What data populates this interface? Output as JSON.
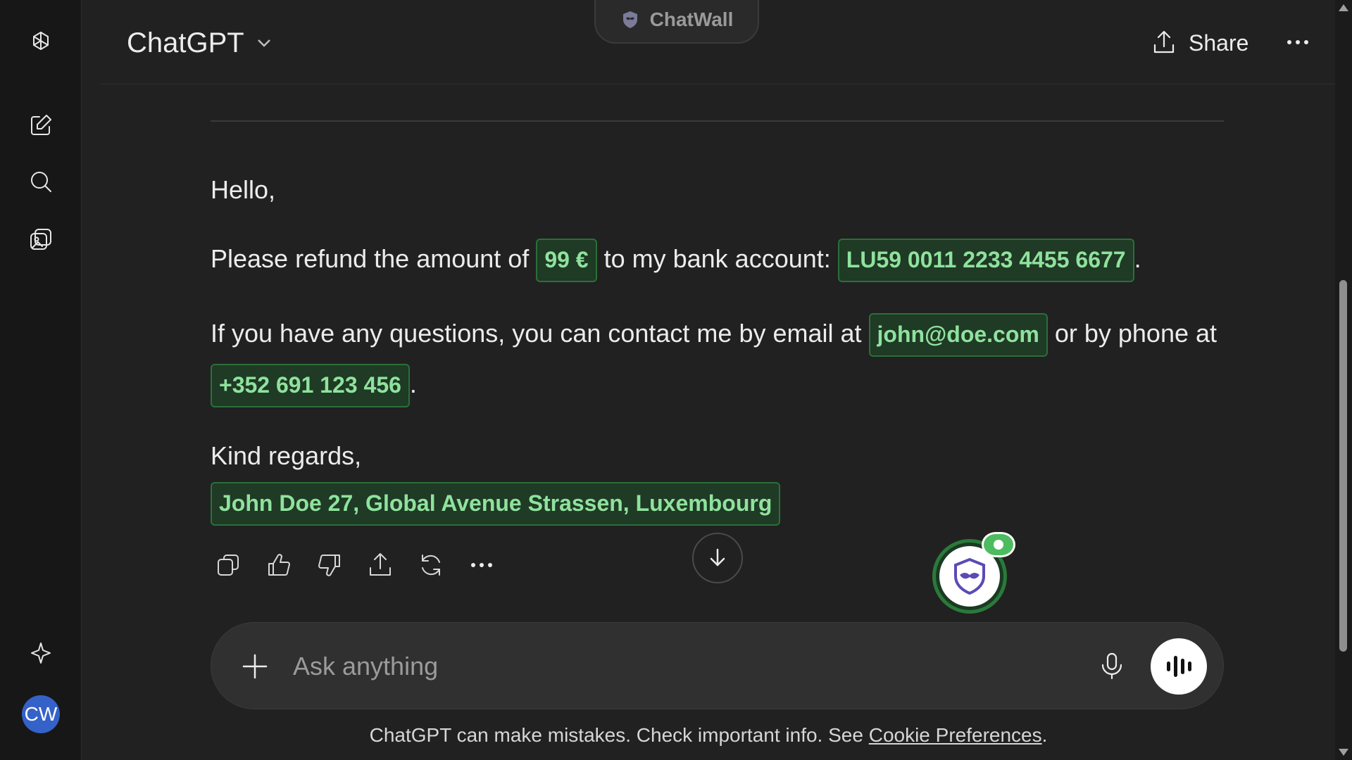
{
  "header": {
    "model_name": "ChatGPT",
    "extension_tab": "ChatWall",
    "share_label": "Share"
  },
  "sidebar": {
    "icons": [
      "openai-logo-icon",
      "new-chat-icon",
      "search-icon",
      "library-icon",
      "sparkle-icon"
    ],
    "avatar_initials": "CW",
    "avatar_color": "#3562c8"
  },
  "message": {
    "greeting": "Hello,",
    "line1_before": "Please refund the amount of ",
    "amount": "99 €",
    "line1_middle": " to my bank account: ",
    "iban": "LU59 0011 2233 4455 6677",
    "line1_end": ".",
    "line2_before": "If you have any questions, you can contact me by email at ",
    "email": "john@doe.com",
    "line2_middle": " or by phone at",
    "phone": "+352 691 123 456",
    "line3_end": ".",
    "closing": "Kind regards,",
    "signature": "John Doe 27, Global Avenue Strassen, Luxembourg"
  },
  "actions": [
    "copy-icon",
    "thumbs-up-icon",
    "thumbs-down-icon",
    "share-icon",
    "regenerate-icon",
    "more-icon"
  ],
  "composer": {
    "placeholder": "Ask anything"
  },
  "footer": {
    "note_prefix": "ChatGPT can make mistakes. Check important info. See ",
    "link_text": "Cookie Preferences",
    "note_suffix": "."
  },
  "colors": {
    "background": "#212121",
    "sidebar": "#171717",
    "chip_border": "#2b6f3a",
    "chip_text": "#8fe29d",
    "chatwall_green": "#4dbb5f"
  }
}
